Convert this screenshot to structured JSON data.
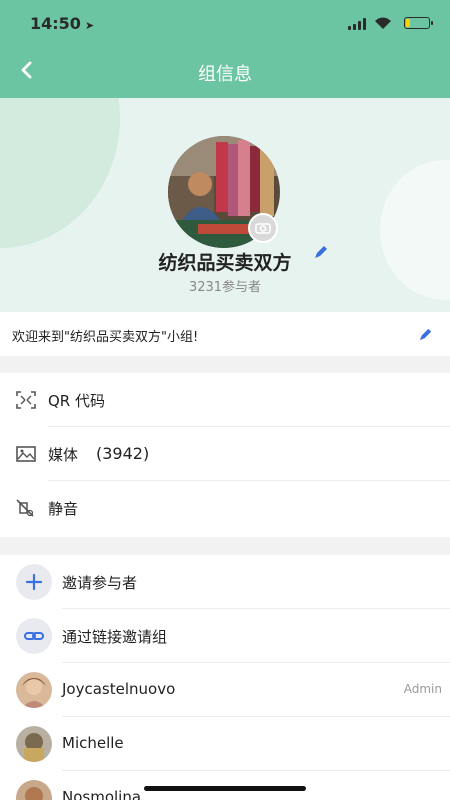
{
  "status_bar": {
    "time": "14:50",
    "location_glyph": "➤"
  },
  "nav": {
    "title": "组信息"
  },
  "header": {
    "group_name": "纺织品买卖双方",
    "member_count": "3231参与者"
  },
  "description": {
    "text": "欢迎来到\"纺织品买卖双方\"小组!"
  },
  "menu": {
    "qr_label": "QR 代码",
    "media_label": "媒体",
    "media_count": "(3942)",
    "mute_label": "静音"
  },
  "members": {
    "invite_label": "邀请参与者",
    "invite_link_label": "通过链接邀请组",
    "items": [
      {
        "name": "Joycastelnuovo",
        "role": "Admin"
      },
      {
        "name": "Michelle",
        "role": ""
      },
      {
        "name": "Nosmolina",
        "role": ""
      }
    ]
  },
  "colors": {
    "header_green": "#6cc5a2",
    "accent_blue": "#3a6fe0"
  }
}
